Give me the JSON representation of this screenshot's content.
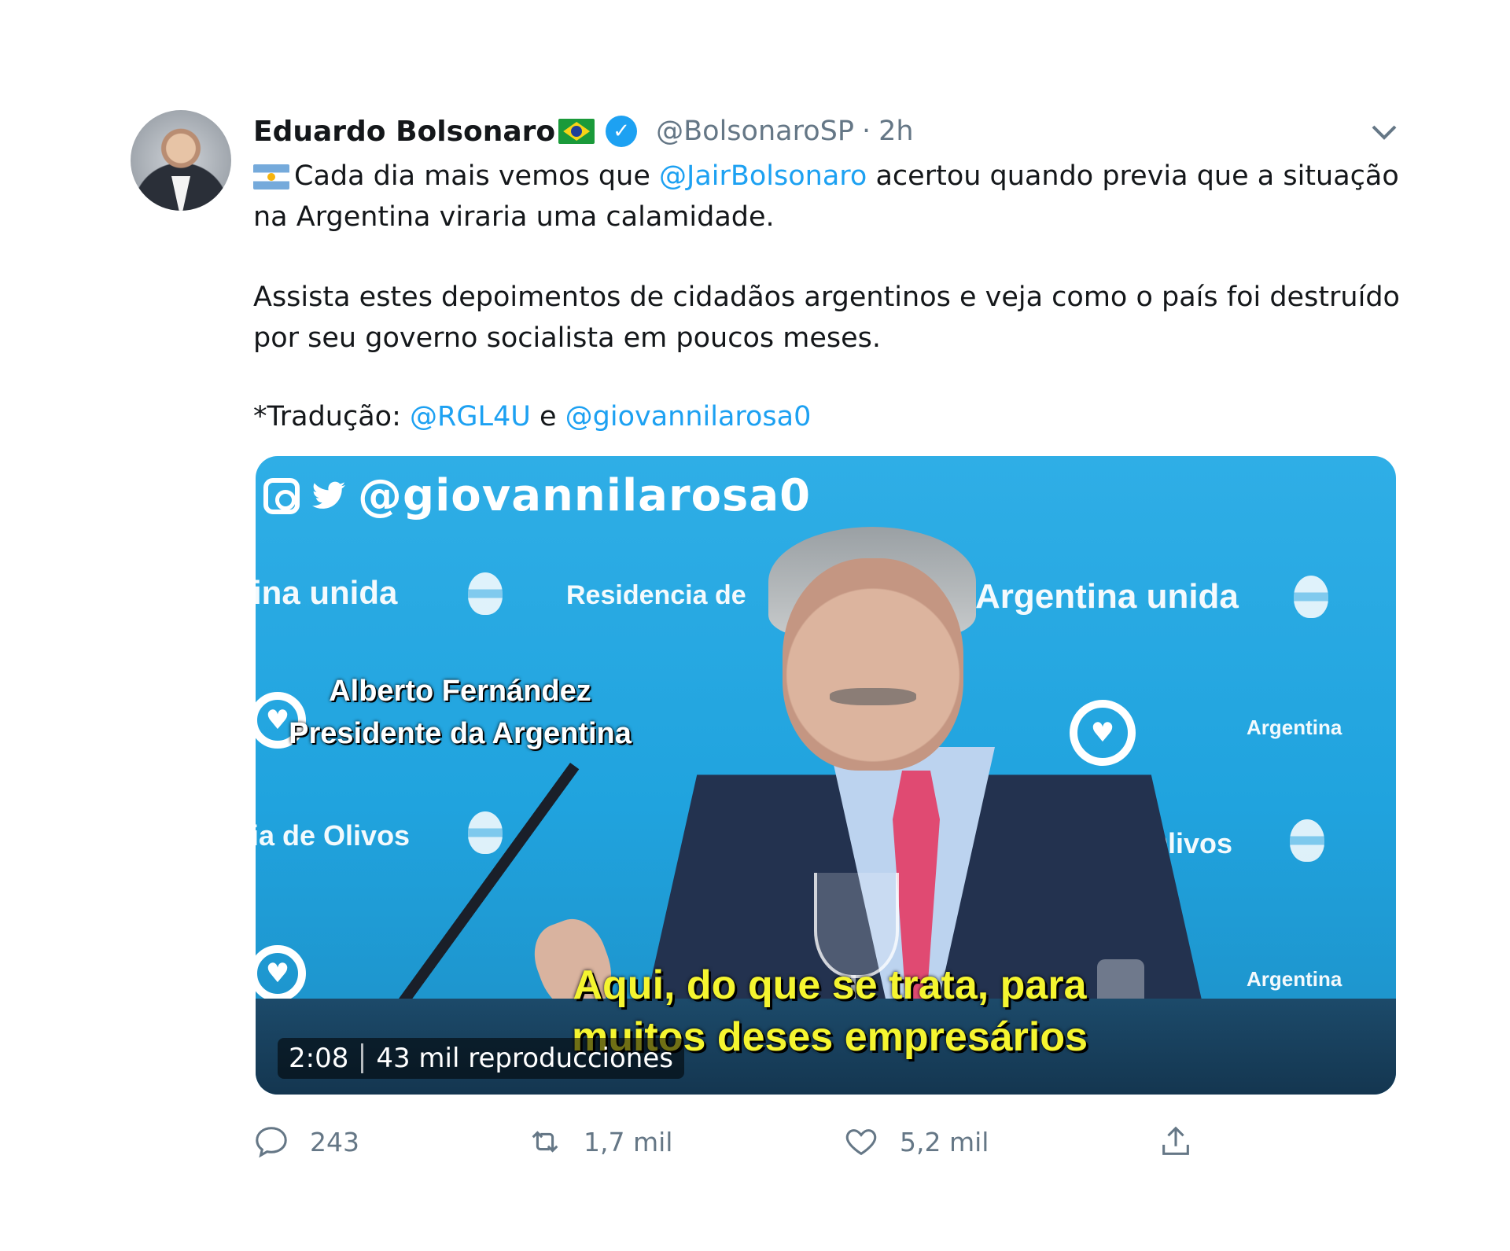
{
  "author": {
    "name": "Eduardo Bolsonaro",
    "handle": "@BolsonaroSP",
    "separator": "·",
    "time": "2h"
  },
  "tweet": {
    "line1_text": "Cada dia mais vemos que ",
    "line1_mention": "@JairBolsonaro",
    "line1_rest": " acertou quando previa que a situação",
    "line2": "na Argentina viraria uma calamidade.",
    "line3": "Assista estes depoimentos de cidadãos argentinos e veja como o país foi destruído",
    "line4": "por seu governo socialista em poucos meses.",
    "credit_prefix": "*Tradução: ",
    "credit_mention1": "@RGL4U",
    "credit_and": " e ",
    "credit_mention2": "@giovannilarosa0"
  },
  "video": {
    "watermark": "@giovannilarosa0",
    "background_texts": [
      "ina unida",
      "Residencia de",
      "Argentina unida",
      "ia de Olivos",
      "de Olivos",
      "Argentina",
      "Argentina"
    ],
    "speaker_name": "Alberto Fernández",
    "speaker_title": "Presidente da Argentina",
    "subtitle_line1": "Aqui, do que se trata, para",
    "subtitle_line2": "muitos deses empresários",
    "duration": "2:08",
    "views": "43 mil reproducciones"
  },
  "actions": {
    "replies": "243",
    "retweets": "1,7 mil",
    "likes": "5,2 mil"
  },
  "colors": {
    "link": "#1da1f2",
    "muted": "#657786",
    "subtitle": "#f5f530"
  },
  "icons": [
    "brazil-flag-icon",
    "verified-badge-icon",
    "chevron-down-icon",
    "argentina-flag-icon",
    "instagram-icon",
    "twitter-bird-icon",
    "reply-icon",
    "retweet-icon",
    "like-icon",
    "share-icon"
  ]
}
